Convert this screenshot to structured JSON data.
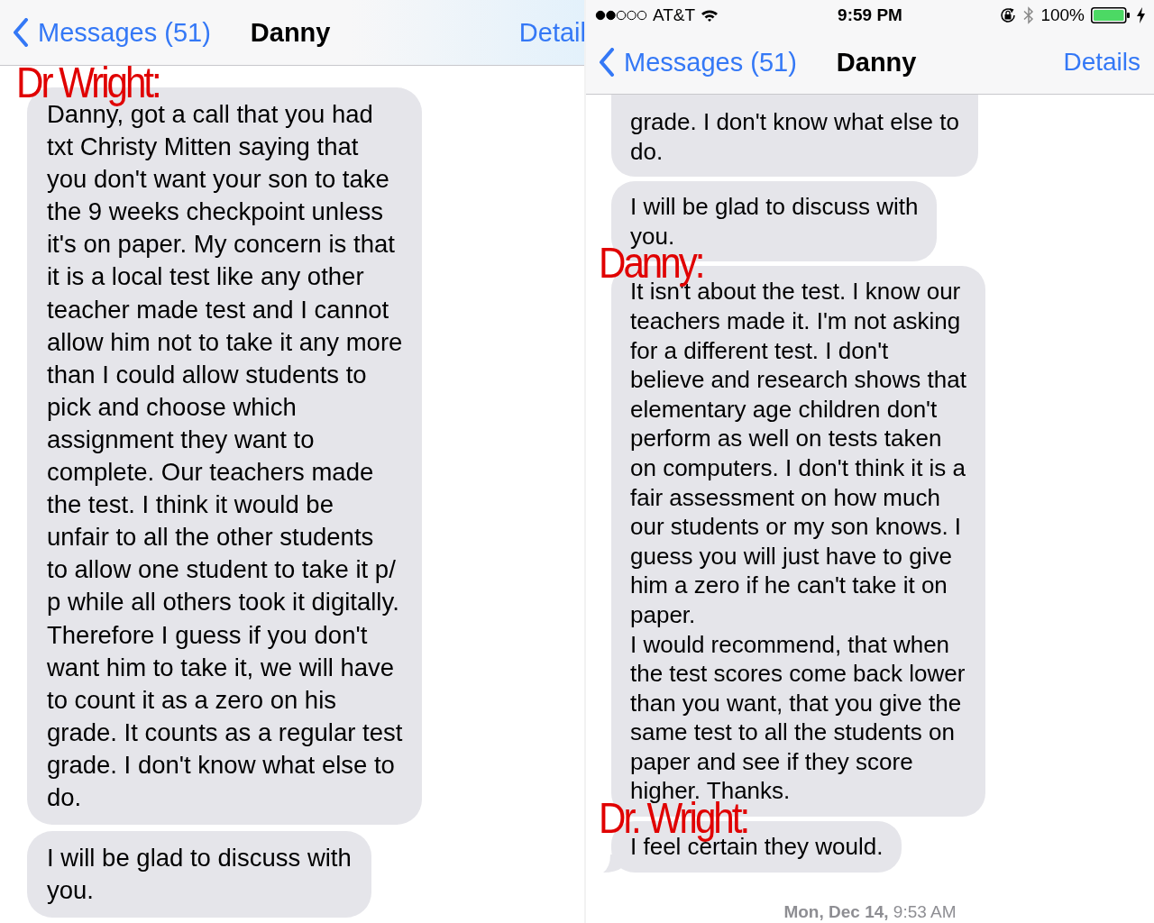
{
  "panels": [
    {
      "nav": {
        "back": "Messages (51)",
        "title": "Danny",
        "action": "Detail"
      },
      "messages": [
        {
          "text": "Danny, got a call that you had\ntxt Christy Mitten saying that\nyou don't want your son to take\nthe 9 weeks checkpoint unless\nit's on paper. My concern is that\nit is a local test like any other\nteacher made test and I cannot\nallow him not to take it any more\nthan I could allow students to\npick and choose which\nassignment they want to\ncomplete. Our teachers made\nthe test. I think it would be\nunfair to all the other students\nto allow one student to take it p/\np while all others took it digitally.\nTherefore I guess if you don't\nwant him to take it, we will have\nto count it as a zero on his\ngrade. It counts as a regular test\ngrade. I don't know what else to\ndo.",
          "annotation": "Dr Wright:",
          "tail": false
        },
        {
          "text": "I will be glad to discuss with\nyou.",
          "tail": false
        }
      ]
    },
    {
      "status_bar": {
        "carrier": "AT&T",
        "time": "9:59 PM",
        "battery": "100%"
      },
      "nav": {
        "back": "Messages (51)",
        "title": "Danny",
        "action": "Details"
      },
      "messages": [
        {
          "text": "grade. I don't know what else to\ndo.",
          "tail": false
        },
        {
          "text": "I will be glad to discuss with\nyou.",
          "tail": false
        },
        {
          "text": "It isn't about the test. I know our\nteachers made it. I'm not asking\nfor a different test. I don't\nbelieve and research shows that\nelementary age children don't\nperform as well on tests taken\non computers. I don't think it is a\nfair assessment on how much\nour students or my son knows. I\nguess you will just have to give\nhim a zero if he can't take it on\npaper.\nI would recommend, that when\nthe test scores come back lower\nthan you want, that you give the\nsame test to all the students on\npaper and see if they score\nhigher. Thanks.",
          "annotation": "Danny:",
          "tail": false
        },
        {
          "text": "I feel certain they would.",
          "annotation": "Dr. Wright:",
          "tail": true
        }
      ],
      "timestamp": "**Mon, Dec 14,** 9:53 AM"
    }
  ]
}
